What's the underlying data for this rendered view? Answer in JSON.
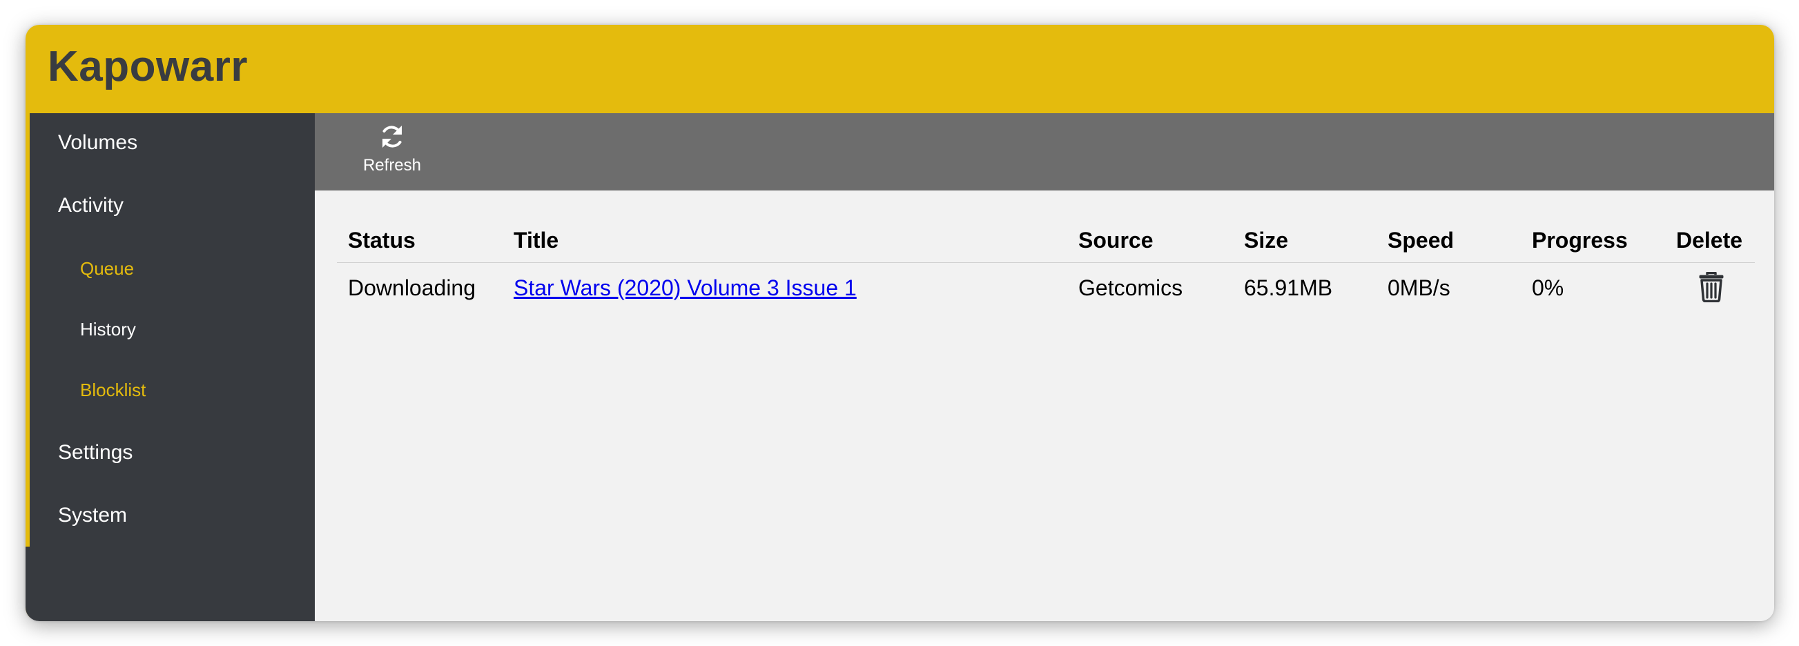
{
  "app": {
    "title": "Kapowarr"
  },
  "sidebar": {
    "items": [
      {
        "label": "Volumes",
        "level": "main",
        "active": false
      },
      {
        "label": "Activity",
        "level": "main",
        "active": false
      },
      {
        "label": "Queue",
        "level": "sub",
        "active": true
      },
      {
        "label": "History",
        "level": "sub",
        "active": false
      },
      {
        "label": "Blocklist",
        "level": "sub",
        "active": true
      },
      {
        "label": "Settings",
        "level": "main",
        "active": false
      },
      {
        "label": "System",
        "level": "main",
        "active": false
      }
    ]
  },
  "toolbar": {
    "refresh_label": "Refresh",
    "refresh_icon": "refresh-icon"
  },
  "queue": {
    "columns": [
      "Status",
      "Title",
      "Source",
      "Size",
      "Speed",
      "Progress",
      "Delete"
    ],
    "rows": [
      {
        "status": "Downloading",
        "title": "Star Wars (2020) Volume 3 Issue 1",
        "source": "Getcomics",
        "size": "65.91MB",
        "speed": "0MB/s",
        "progress": "0%",
        "delete_icon": "trash-icon"
      }
    ]
  },
  "colors": {
    "accent": "#e4bb0d",
    "sidebar_bg": "#373a3f",
    "toolbar_bg": "#6d6d6d",
    "content_bg": "#f2f2f2",
    "link": "#0000ee"
  }
}
